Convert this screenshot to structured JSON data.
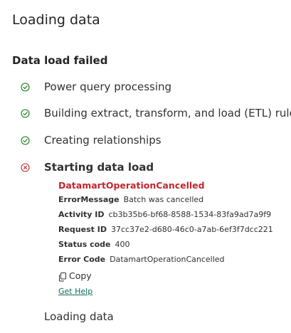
{
  "header": {
    "title": "Loading data"
  },
  "status": {
    "heading": "Data load failed"
  },
  "steps": [
    {
      "label": "Power query processing",
      "state": "success",
      "icon": "check-circle-icon"
    },
    {
      "label": "Building extract, transform, and load (ETL) rules",
      "state": "success",
      "icon": "check-circle-icon"
    },
    {
      "label": "Creating relationships",
      "state": "success",
      "icon": "check-circle-icon"
    },
    {
      "label": "Starting data load",
      "state": "failed",
      "icon": "error-circle-icon"
    },
    {
      "label": "Loading data",
      "state": "pending"
    }
  ],
  "error": {
    "title": "DatamartOperationCancelled",
    "details": [
      {
        "key": "ErrorMessage",
        "value": "Batch was cancelled"
      },
      {
        "key": "Activity ID",
        "value": "cb3b35b6-bf68-8588-1534-83fa9ad7a9f9"
      },
      {
        "key": "Request ID",
        "value": "37cc37e2-d680-46c0-a7ab-6ef3f7dcc221"
      },
      {
        "key": "Status code",
        "value": "400"
      },
      {
        "key": "Error Code",
        "value": "DatamartOperationCancelled"
      }
    ],
    "copy_label": "Copy",
    "help_label": "Get Help"
  },
  "colors": {
    "success": "#107c10",
    "error": "#c4262e",
    "link": "#0f6b5c",
    "text": "#323130"
  }
}
